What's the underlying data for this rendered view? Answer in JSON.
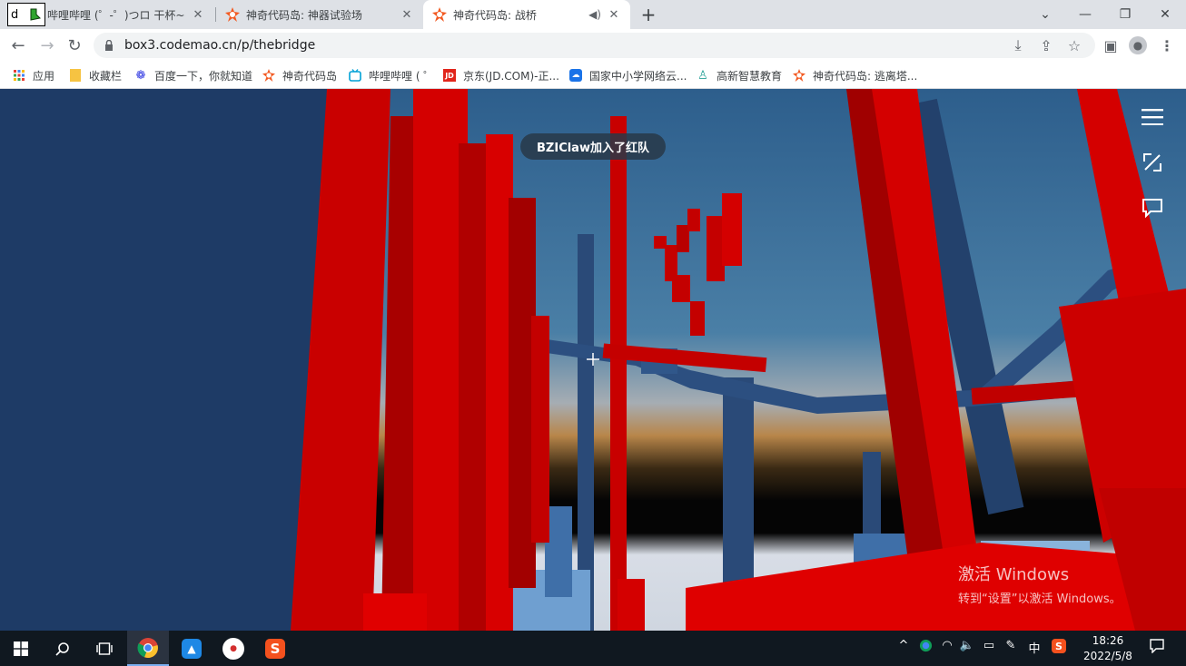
{
  "browser": {
    "tabs": [
      {
        "title": "哔哩哔哩 (゜-゜)つロ 干杯~-bilibili",
        "active": false
      },
      {
        "title": "神奇代码岛: 神器试验场",
        "active": false
      },
      {
        "title": "神奇代码岛: 战桥",
        "active": true
      }
    ],
    "tab_extra_label": "d",
    "address": "box3.codemao.cn/p/thebridge"
  },
  "bookmarks": [
    {
      "label": "应用",
      "icon": "apps-grid-icon"
    },
    {
      "label": "收藏栏",
      "icon": "folder-icon"
    },
    {
      "label": "百度一下，你就知道",
      "icon": "baidu-icon"
    },
    {
      "label": "神奇代码岛",
      "icon": "codemao-icon"
    },
    {
      "label": "哔哩哔哩 ( ゜",
      "icon": "bilibili-icon"
    },
    {
      "label": "京东(JD.COM)-正...",
      "icon": "jd-icon"
    },
    {
      "label": "国家中小学网络云...",
      "icon": "edu-cloud-icon"
    },
    {
      "label": "高新智慧教育",
      "icon": "gaoxin-icon"
    },
    {
      "label": "神奇代码岛: 逃离塔...",
      "icon": "codemao-icon"
    }
  ],
  "game": {
    "notification": "BZIClaw加入了红队"
  },
  "watermark": {
    "line1": "激活 Windows",
    "line2": "转到“设置”以激活 Windows。"
  },
  "taskbar": {
    "time": "18:26",
    "date": "2022/5/8",
    "ime": "中"
  },
  "colors": {
    "red_team": "#d40000",
    "blue_blocks": "#2a4a78",
    "sky_top": "#2f5f8f",
    "taskbar_bg": "#101820"
  }
}
